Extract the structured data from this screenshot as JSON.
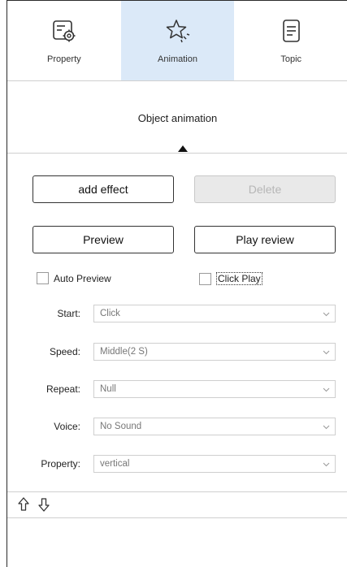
{
  "tabs": [
    {
      "label": "Property",
      "icon": "property-settings-icon",
      "active": false
    },
    {
      "label": "Animation",
      "icon": "star-animation-icon",
      "active": true
    },
    {
      "label": "Topic",
      "icon": "document-topic-icon",
      "active": false
    }
  ],
  "section": {
    "title": "Object animation"
  },
  "buttons": {
    "add_effect": "add effect",
    "delete": "Delete",
    "preview": "Preview",
    "play_review": "Play review"
  },
  "checkboxes": {
    "auto_preview": {
      "label": "Auto Preview",
      "checked": false
    },
    "click_play": {
      "label": "Click Play",
      "checked": false
    }
  },
  "fields": {
    "start": {
      "label": "Start:",
      "value": "Click"
    },
    "speed": {
      "label": "Speed:",
      "value": "Middle(2 S)"
    },
    "repeat": {
      "label": "Repeat:",
      "value": "Null"
    },
    "voice": {
      "label": "Voice:",
      "value": "No Sound"
    },
    "property": {
      "label": "Property:",
      "value": "vertical"
    }
  },
  "order_controls": {
    "up_icon": "arrow-up-icon",
    "down_icon": "arrow-down-icon"
  },
  "colors": {
    "active_tab": "#dbe9f8",
    "border": "#2b2b2b",
    "disabled_bg": "#e9e9e9"
  }
}
